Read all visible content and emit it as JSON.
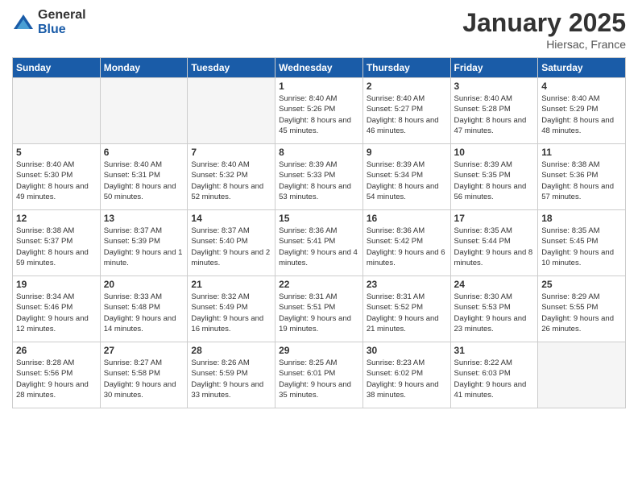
{
  "logo": {
    "general": "General",
    "blue": "Blue"
  },
  "header": {
    "month": "January 2025",
    "location": "Hiersac, France"
  },
  "days_of_week": [
    "Sunday",
    "Monday",
    "Tuesday",
    "Wednesday",
    "Thursday",
    "Friday",
    "Saturday"
  ],
  "weeks": [
    [
      {
        "day": "",
        "empty": true
      },
      {
        "day": "",
        "empty": true
      },
      {
        "day": "",
        "empty": true
      },
      {
        "day": "1",
        "sunrise": "Sunrise: 8:40 AM",
        "sunset": "Sunset: 5:26 PM",
        "daylight": "Daylight: 8 hours and 45 minutes."
      },
      {
        "day": "2",
        "sunrise": "Sunrise: 8:40 AM",
        "sunset": "Sunset: 5:27 PM",
        "daylight": "Daylight: 8 hours and 46 minutes."
      },
      {
        "day": "3",
        "sunrise": "Sunrise: 8:40 AM",
        "sunset": "Sunset: 5:28 PM",
        "daylight": "Daylight: 8 hours and 47 minutes."
      },
      {
        "day": "4",
        "sunrise": "Sunrise: 8:40 AM",
        "sunset": "Sunset: 5:29 PM",
        "daylight": "Daylight: 8 hours and 48 minutes."
      }
    ],
    [
      {
        "day": "5",
        "sunrise": "Sunrise: 8:40 AM",
        "sunset": "Sunset: 5:30 PM",
        "daylight": "Daylight: 8 hours and 49 minutes."
      },
      {
        "day": "6",
        "sunrise": "Sunrise: 8:40 AM",
        "sunset": "Sunset: 5:31 PM",
        "daylight": "Daylight: 8 hours and 50 minutes."
      },
      {
        "day": "7",
        "sunrise": "Sunrise: 8:40 AM",
        "sunset": "Sunset: 5:32 PM",
        "daylight": "Daylight: 8 hours and 52 minutes."
      },
      {
        "day": "8",
        "sunrise": "Sunrise: 8:39 AM",
        "sunset": "Sunset: 5:33 PM",
        "daylight": "Daylight: 8 hours and 53 minutes."
      },
      {
        "day": "9",
        "sunrise": "Sunrise: 8:39 AM",
        "sunset": "Sunset: 5:34 PM",
        "daylight": "Daylight: 8 hours and 54 minutes."
      },
      {
        "day": "10",
        "sunrise": "Sunrise: 8:39 AM",
        "sunset": "Sunset: 5:35 PM",
        "daylight": "Daylight: 8 hours and 56 minutes."
      },
      {
        "day": "11",
        "sunrise": "Sunrise: 8:38 AM",
        "sunset": "Sunset: 5:36 PM",
        "daylight": "Daylight: 8 hours and 57 minutes."
      }
    ],
    [
      {
        "day": "12",
        "sunrise": "Sunrise: 8:38 AM",
        "sunset": "Sunset: 5:37 PM",
        "daylight": "Daylight: 8 hours and 59 minutes."
      },
      {
        "day": "13",
        "sunrise": "Sunrise: 8:37 AM",
        "sunset": "Sunset: 5:39 PM",
        "daylight": "Daylight: 9 hours and 1 minute."
      },
      {
        "day": "14",
        "sunrise": "Sunrise: 8:37 AM",
        "sunset": "Sunset: 5:40 PM",
        "daylight": "Daylight: 9 hours and 2 minutes."
      },
      {
        "day": "15",
        "sunrise": "Sunrise: 8:36 AM",
        "sunset": "Sunset: 5:41 PM",
        "daylight": "Daylight: 9 hours and 4 minutes."
      },
      {
        "day": "16",
        "sunrise": "Sunrise: 8:36 AM",
        "sunset": "Sunset: 5:42 PM",
        "daylight": "Daylight: 9 hours and 6 minutes."
      },
      {
        "day": "17",
        "sunrise": "Sunrise: 8:35 AM",
        "sunset": "Sunset: 5:44 PM",
        "daylight": "Daylight: 9 hours and 8 minutes."
      },
      {
        "day": "18",
        "sunrise": "Sunrise: 8:35 AM",
        "sunset": "Sunset: 5:45 PM",
        "daylight": "Daylight: 9 hours and 10 minutes."
      }
    ],
    [
      {
        "day": "19",
        "sunrise": "Sunrise: 8:34 AM",
        "sunset": "Sunset: 5:46 PM",
        "daylight": "Daylight: 9 hours and 12 minutes."
      },
      {
        "day": "20",
        "sunrise": "Sunrise: 8:33 AM",
        "sunset": "Sunset: 5:48 PM",
        "daylight": "Daylight: 9 hours and 14 minutes."
      },
      {
        "day": "21",
        "sunrise": "Sunrise: 8:32 AM",
        "sunset": "Sunset: 5:49 PM",
        "daylight": "Daylight: 9 hours and 16 minutes."
      },
      {
        "day": "22",
        "sunrise": "Sunrise: 8:31 AM",
        "sunset": "Sunset: 5:51 PM",
        "daylight": "Daylight: 9 hours and 19 minutes."
      },
      {
        "day": "23",
        "sunrise": "Sunrise: 8:31 AM",
        "sunset": "Sunset: 5:52 PM",
        "daylight": "Daylight: 9 hours and 21 minutes."
      },
      {
        "day": "24",
        "sunrise": "Sunrise: 8:30 AM",
        "sunset": "Sunset: 5:53 PM",
        "daylight": "Daylight: 9 hours and 23 minutes."
      },
      {
        "day": "25",
        "sunrise": "Sunrise: 8:29 AM",
        "sunset": "Sunset: 5:55 PM",
        "daylight": "Daylight: 9 hours and 26 minutes."
      }
    ],
    [
      {
        "day": "26",
        "sunrise": "Sunrise: 8:28 AM",
        "sunset": "Sunset: 5:56 PM",
        "daylight": "Daylight: 9 hours and 28 minutes."
      },
      {
        "day": "27",
        "sunrise": "Sunrise: 8:27 AM",
        "sunset": "Sunset: 5:58 PM",
        "daylight": "Daylight: 9 hours and 30 minutes."
      },
      {
        "day": "28",
        "sunrise": "Sunrise: 8:26 AM",
        "sunset": "Sunset: 5:59 PM",
        "daylight": "Daylight: 9 hours and 33 minutes."
      },
      {
        "day": "29",
        "sunrise": "Sunrise: 8:25 AM",
        "sunset": "Sunset: 6:01 PM",
        "daylight": "Daylight: 9 hours and 35 minutes."
      },
      {
        "day": "30",
        "sunrise": "Sunrise: 8:23 AM",
        "sunset": "Sunset: 6:02 PM",
        "daylight": "Daylight: 9 hours and 38 minutes."
      },
      {
        "day": "31",
        "sunrise": "Sunrise: 8:22 AM",
        "sunset": "Sunset: 6:03 PM",
        "daylight": "Daylight: 9 hours and 41 minutes."
      },
      {
        "day": "",
        "empty": true
      }
    ]
  ]
}
